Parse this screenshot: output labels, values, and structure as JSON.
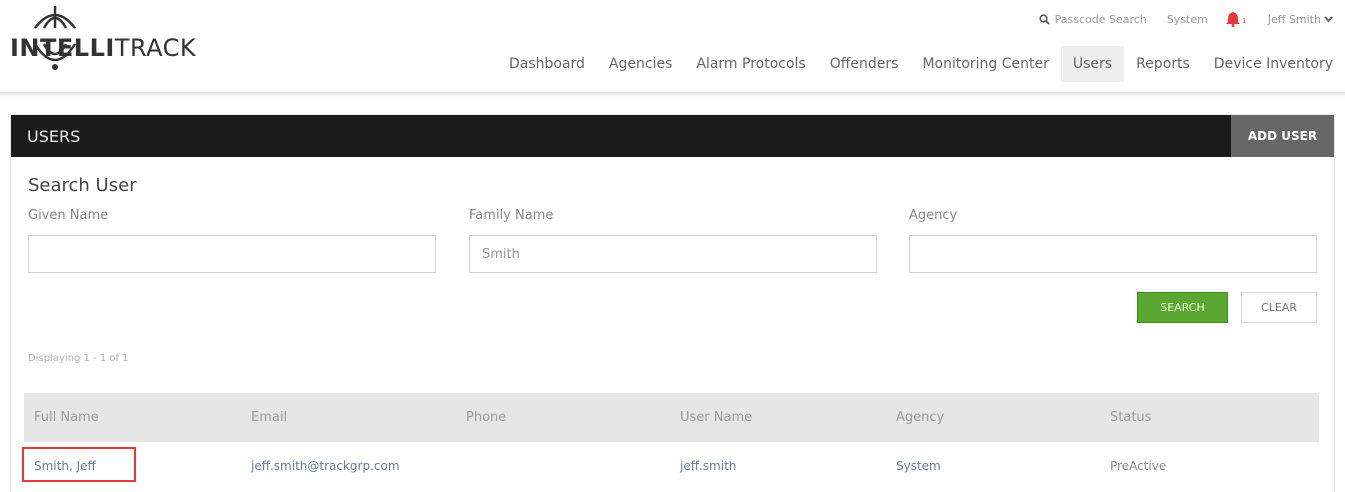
{
  "brand": {
    "prefix": "INTELLI",
    "suffix": "TRACK",
    "colors": {
      "logo": "#333333"
    }
  },
  "utility": {
    "search_label": "Passcode Search",
    "system_label": "System",
    "notification_count": "1",
    "user_name": "Jeff Smith"
  },
  "nav": {
    "items": [
      {
        "label": "Dashboard"
      },
      {
        "label": "Agencies"
      },
      {
        "label": "Alarm Protocols"
      },
      {
        "label": "Offenders"
      },
      {
        "label": "Monitoring Center"
      },
      {
        "label": "Users",
        "active": true
      },
      {
        "label": "Reports"
      },
      {
        "label": "Device Inventory"
      }
    ]
  },
  "panel": {
    "title": "USERS",
    "add_button": "ADD USER"
  },
  "search": {
    "title": "Search User",
    "given_name": {
      "label": "Given Name",
      "value": ""
    },
    "family_name": {
      "label": "Family Name",
      "value": "Smith"
    },
    "agency": {
      "label": "Agency",
      "value": ""
    },
    "search_button": "SEARCH",
    "clear_button": "CLEAR"
  },
  "results": {
    "summary": "Displaying 1 - 1 of 1",
    "columns": [
      "Full Name",
      "Email",
      "Phone",
      "User Name",
      "Agency",
      "Status"
    ],
    "rows": [
      {
        "full_name": "Smith, Jeff",
        "email": "jeff.smith@trackgrp.com",
        "phone": "",
        "user_name": "jeff.smith",
        "agency": "System",
        "status": "PreActive",
        "highlighted": true
      }
    ]
  },
  "colors": {
    "accent_green": "#5aa832",
    "header_dark": "#1b1b1b",
    "link": "#5b7ea5",
    "alert_red": "#e53935"
  }
}
